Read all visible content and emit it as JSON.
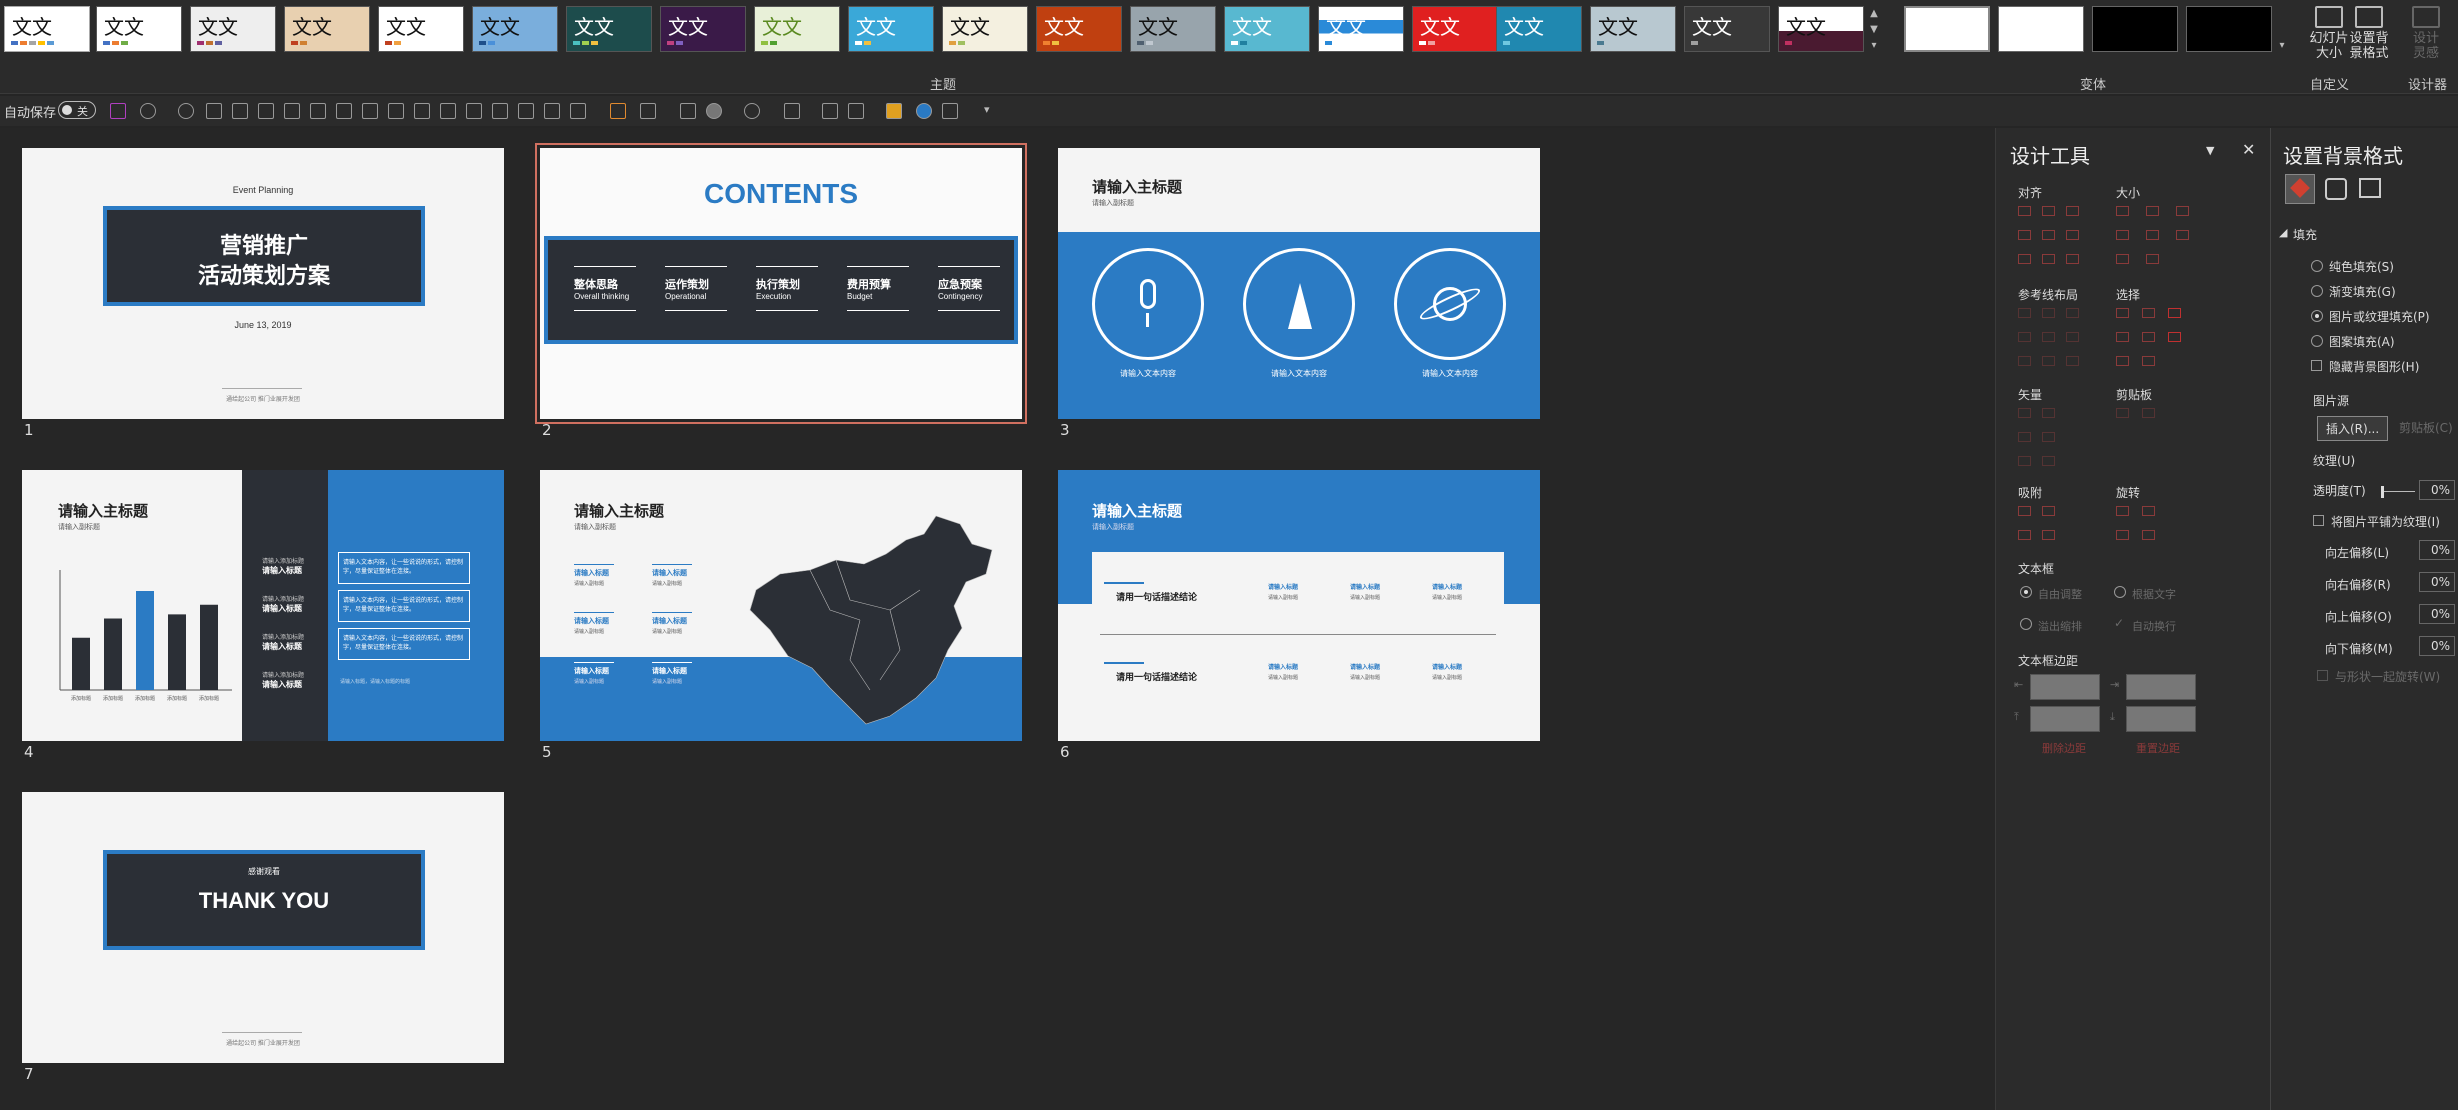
{
  "ribbon": {
    "themes_label": "主题",
    "variants_label": "变体",
    "custom_label": "自定义",
    "designer_label": "设计器",
    "theme_sample_text": "文文",
    "slide_size_label": "幻灯片\n大小",
    "format_bg_label": "设置背\n景格式",
    "designer_button_label": "设计\n灵感"
  },
  "qat": {
    "autosave_label": "自动保存",
    "autosave_state": "关"
  },
  "slides": [
    {
      "number": "1",
      "event": "Event Planning",
      "title1": "营销推广",
      "title2": "活动策划方案",
      "date": "June 13, 2019",
      "footer": "通给起公司 推门业展开发团"
    },
    {
      "number": "2",
      "title": "CONTENTS",
      "items": [
        {
          "cn": "整体思路",
          "en": "Overall thinking"
        },
        {
          "cn": "运作策划",
          "en": "Operational"
        },
        {
          "cn": "执行策划",
          "en": "Execution"
        },
        {
          "cn": "费用预算",
          "en": "Budget"
        },
        {
          "cn": "应急预案",
          "en": "Contingency"
        }
      ]
    },
    {
      "number": "3",
      "title": "请输入主标题",
      "subtitle": "请输入副标题",
      "circle_text": "请输入文本内容"
    },
    {
      "number": "4",
      "title": "请输入主标题",
      "subtitle": "请输入副标题",
      "bar_values": [
        38,
        52,
        72,
        55,
        62
      ],
      "bar_labels": [
        "添加标题",
        "添加标题",
        "添加标题",
        "添加标题",
        "添加标题"
      ],
      "item_small": "请输入添加标题",
      "item_big": "请输入标题",
      "box_text": "请输入文本内容，让一些说说的形式，请控制字，尽量保证整体在连接。",
      "box_footer": "请输入标题，请输入标题的标题"
    },
    {
      "number": "5",
      "title": "请输入主标题",
      "subtitle": "请输入副标题",
      "item_title": "请输入标题",
      "item_sub": "请输入副标题"
    },
    {
      "number": "6",
      "title": "请输入主标题",
      "subtitle": "请输入副标题",
      "conclusion": "请用一句话描述结论",
      "col_title": "请输入标题",
      "col_sub": "请输入副标题"
    },
    {
      "number": "7",
      "top": "感谢观看",
      "title": "THANK YOU",
      "footer": "通给起公司 推门业展开发团"
    }
  ],
  "design_pane": {
    "title": "设计工具",
    "align": "对齐",
    "size": "大小",
    "guides": "参考线布局",
    "select": "选择",
    "vector": "矢量",
    "clipboard": "剪贴板",
    "snap": "吸附",
    "rotate": "旋转",
    "textbox": "文本框",
    "autofit": "自由调整",
    "fit_text": "根据文字",
    "overflow": "溢出缩排",
    "autowrap": "自动换行",
    "margin": "文本框边距",
    "delete_margin": "删除边距",
    "reset_margin": "重置边距"
  },
  "bg_pane": {
    "title": "设置背景格式",
    "fill": "填充",
    "options": [
      "纯色填充(S)",
      "渐变填充(G)",
      "图片或纹理填充(P)",
      "图案填充(A)"
    ],
    "selected_option": 2,
    "hide_bg": "隐藏背景图形(H)",
    "image_source": "图片源",
    "insert": "插入(R)...",
    "clipboard": "剪贴板(C)",
    "texture": "纹理(U)",
    "transparency": "透明度(T)",
    "transparency_value": "0%",
    "tile": "将图片平铺为纹理(I)",
    "offset_left": "向左偏移(L)",
    "offset_right": "向右偏移(R)",
    "offset_up": "向上偏移(O)",
    "offset_down": "向下偏移(M)",
    "offset_value": "0%",
    "rotate_with": "与形状一起旋转(W)"
  }
}
